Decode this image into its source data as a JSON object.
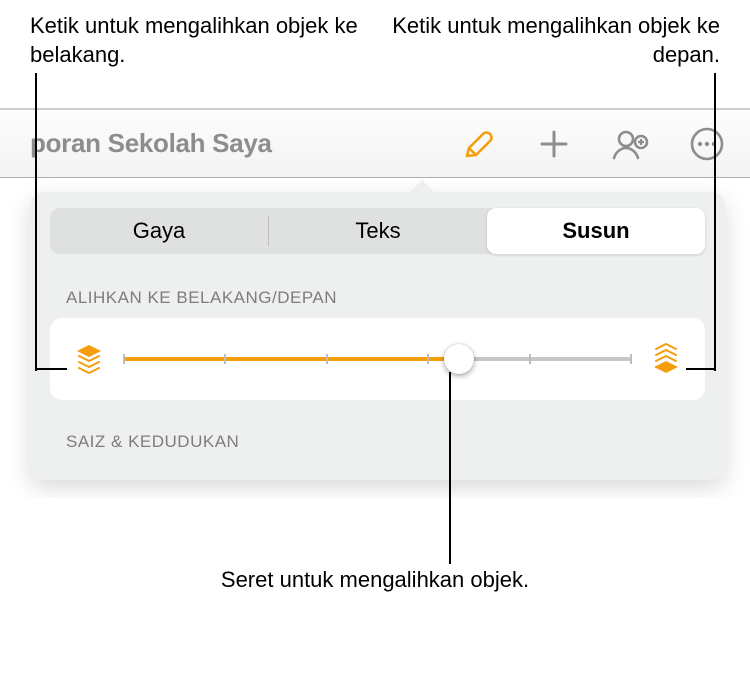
{
  "callouts": {
    "left": "Ketik untuk mengalihkan objek ke belakang.",
    "right": "Ketik untuk mengalihkan objek ke depan.",
    "bottom": "Seret untuk mengalihkan objek."
  },
  "toolbar": {
    "document_title": "poran Sekolah Saya"
  },
  "inspector": {
    "tabs": {
      "style": "Gaya",
      "text": "Teks",
      "arrange": "Susun"
    },
    "sections": {
      "move_header": "ALIHKAN KE BELAKANG/DEPAN",
      "size_header": "SAIZ & KEDUDUKAN"
    },
    "slider": {
      "value_pct": 66,
      "ticks": 6
    }
  },
  "colors": {
    "accent": "#f59e0b"
  }
}
